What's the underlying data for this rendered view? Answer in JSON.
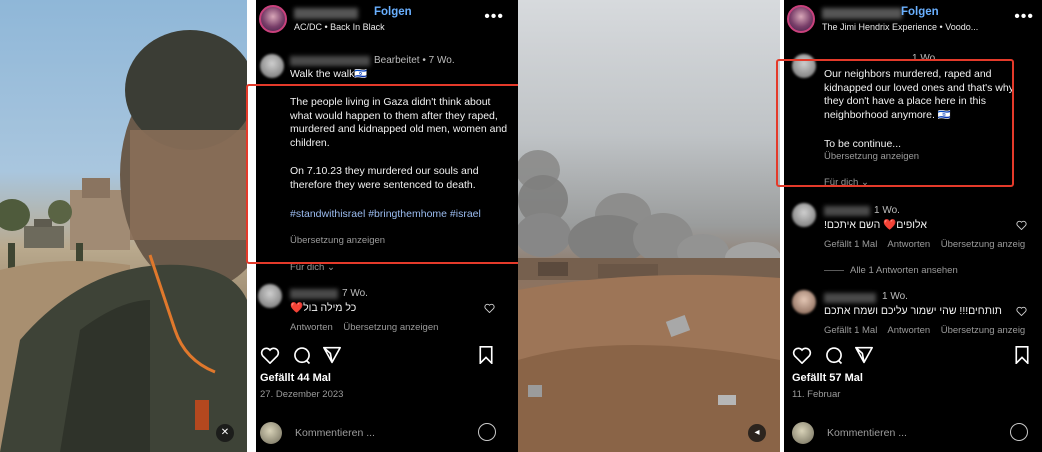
{
  "left_post": {
    "follow": "Folgen",
    "subtitle": "AC/DC • Back In Black",
    "caption_edited": "Bearbeitet",
    "caption_age": "7 Wo.",
    "caption_line1": "Walk the walk🇮🇱",
    "caption_para1": "The people living in Gaza didn't think about what would happen to them after they raped, murdered and kidnapped old men, women and children.",
    "caption_para2": "On 7.10.23 they murdered our souls and therefore they were sentenced to death.",
    "caption_tags": "#standwithisrael #bringthemhome #israel",
    "translate": "Übersetzung anzeigen",
    "for_you": "Für dich",
    "comment": {
      "age": "7 Wo.",
      "text": "כל מילה בול❤️",
      "reply": "Antworten",
      "translate": "Übersetzung anzeigen"
    },
    "likes": "Gefällt 44 Mal",
    "date": "27. Dezember 2023",
    "comment_placeholder": "Kommentieren ..."
  },
  "right_post": {
    "follow": "Folgen",
    "subtitle": "The Jimi Hendrix Experience • Voodo...",
    "caption_age": "1 Wo.",
    "caption_para1": "Our neighbors murdered, raped and kidnapped our loved ones and that's why they don't have a place here in this neighborhood anymore. 🇮🇱",
    "caption_para2": "To be continue...",
    "translate": "Übersetzung anzeigen",
    "for_you": "Für dich",
    "comment1": {
      "age": "1 Wo.",
      "text": "אלופים❤️ השם איתכם!",
      "likes": "Gefällt 1 Mal",
      "reply": "Antworten",
      "translate": "Übersetzung anzeig",
      "view_replies": "Alle 1 Antworten ansehen"
    },
    "comment2": {
      "age": "1 Wo.",
      "text": "תותחים!!! שהי ישמור עליכם ושמח אתכם",
      "likes": "Gefällt 1 Mal",
      "reply": "Antworten",
      "translate": "Übersetzung anzeig"
    },
    "likes": "Gefällt 57 Mal",
    "date": "11. Februar",
    "comment_placeholder": "Kommentieren ..."
  },
  "colors": {
    "highlight_box": "#e43a2a",
    "link_blue": "#6ab0ff",
    "heart_red": "#ff3040"
  }
}
